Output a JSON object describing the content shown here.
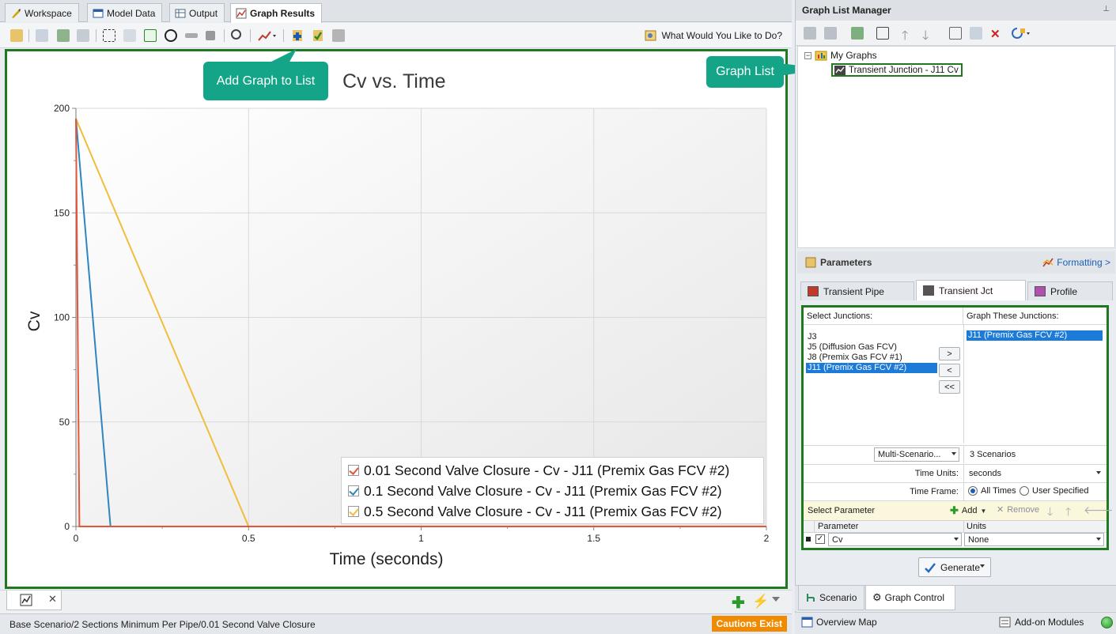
{
  "main_tabs": [
    {
      "label": "Workspace",
      "icon": "workspace-icon"
    },
    {
      "label": "Model Data",
      "icon": "model-data-icon"
    },
    {
      "label": "Output",
      "icon": "output-icon"
    },
    {
      "label": "Graph Results",
      "icon": "graph-results-icon",
      "active": true
    }
  ],
  "toolbar": {
    "what_would_you_like": "What Would You Like to Do?"
  },
  "callouts": {
    "add_graph": "Add Graph to List",
    "graph_list": "Graph List"
  },
  "chart_data": {
    "type": "line",
    "title": "Cv vs. Time",
    "xlabel": "Time (seconds)",
    "ylabel": "Cv",
    "xlim": [
      0,
      2
    ],
    "ylim": [
      0,
      200
    ],
    "x_ticks": [
      "0",
      "0.5",
      "1",
      "1.5",
      "2"
    ],
    "y_ticks": [
      "0",
      "50",
      "100",
      "150",
      "200"
    ],
    "grid": true,
    "legend_position": "bottom-right",
    "series": [
      {
        "name": "0.01 Second Valve Closure - Cv - J11 (Premix Gas FCV #2)",
        "color": "#e4553a",
        "x": [
          0,
          0.01,
          2
        ],
        "y": [
          195,
          0,
          0
        ]
      },
      {
        "name": "0.1 Second Valve Closure - Cv - J11 (Premix Gas FCV #2)",
        "color": "#2e86c1",
        "x": [
          0,
          0.1,
          2
        ],
        "y": [
          195,
          0,
          0
        ]
      },
      {
        "name": "0.5 Second Valve Closure - Cv - J11 (Premix Gas FCV #2)",
        "color": "#f2bd3c",
        "x": [
          0,
          0.5,
          2
        ],
        "y": [
          195,
          0,
          0
        ]
      }
    ]
  },
  "status_bar": {
    "text": "Base Scenario/2 Sections Minimum Per Pipe/0.01 Second Valve Closure",
    "cautions": "Cautions Exist"
  },
  "graph_list_manager": {
    "title": "Graph List Manager",
    "root": "My Graphs",
    "items": [
      "Transient Junction - J11 Cv"
    ]
  },
  "parameters": {
    "title": "Parameters",
    "formatting": "Formatting >",
    "tabs": [
      {
        "label": "Transient Pipe",
        "color": "#c0392b"
      },
      {
        "label": "Transient Jct",
        "color": "#555555",
        "active": true
      },
      {
        "label": "Profile",
        "color": "#b04fb0"
      }
    ],
    "select_junctions_label": "Select Junctions:",
    "graph_these_label": "Graph These Junctions:",
    "available_junctions": [
      "J3",
      "J5 (Diffusion Gas FCV)",
      "J8 (Premix Gas FCV #1)",
      "J11 (Premix Gas FCV #2)"
    ],
    "selected_available_index": 3,
    "graphed_junctions": [
      "J11 (Premix Gas FCV #2)"
    ],
    "buttons": {
      "add_one": ">",
      "remove_one": "<",
      "remove_all": "<<"
    },
    "multi_scenario": "Multi-Scenario...",
    "scenario_count": "3 Scenarios",
    "time_units_label": "Time Units:",
    "time_units_value": "seconds",
    "time_frame_label": "Time Frame:",
    "time_frame_all": "All Times",
    "time_frame_user": "User Specified",
    "select_parameter": "Select Parameter",
    "add": "Add",
    "remove": "Remove",
    "grid_headers": [
      "Parameter",
      "Units"
    ],
    "grid_rows": [
      {
        "parameter": "Cv",
        "units": "None"
      }
    ],
    "generate": "Generate"
  },
  "right_bottom_tabs": [
    {
      "label": "Scenario"
    },
    {
      "label": "Graph Control",
      "active": true
    }
  ],
  "right_status": {
    "overview": "Overview Map",
    "addon": "Add-on Modules"
  }
}
